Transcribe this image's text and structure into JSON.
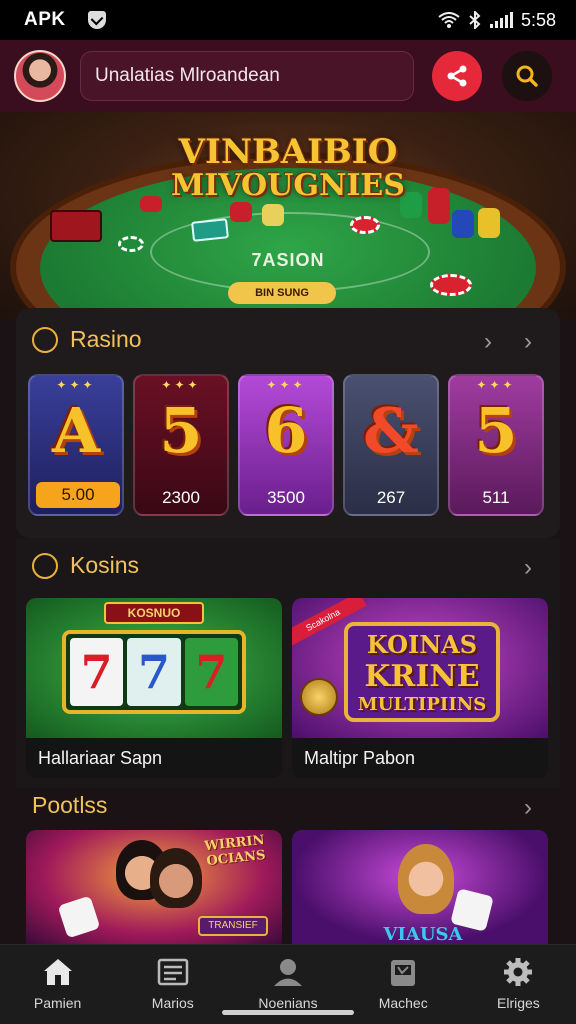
{
  "status_bar": {
    "left_text": "APK",
    "time": "5:58"
  },
  "header": {
    "search_text": "Unalatias Mlroandean",
    "share_icon": "share-icon",
    "search_icon": "search-icon"
  },
  "hero": {
    "title_line1": "VINBAIBIO",
    "title_line2": "MIVOUGNIES",
    "table_text": "7ASION",
    "pill_text": "BIN SUNG"
  },
  "section1": {
    "title": "Rasino",
    "cards": [
      {
        "letter": "A",
        "value": "5.00",
        "color_top": "#3a3f9a",
        "color_bottom": "#1e1f5c"
      },
      {
        "letter": "5",
        "value": "2300",
        "color_top": "#6a1024",
        "color_bottom": "#3a0815"
      },
      {
        "letter": "6",
        "value": "3500",
        "color_top": "#b44ad8",
        "color_bottom": "#6a1f8c"
      },
      {
        "letter": "&",
        "value": "267",
        "color_top": "#4a5070",
        "color_bottom": "#2a2e46"
      },
      {
        "letter": "5",
        "value": "511",
        "color_top": "#a03ca0",
        "color_bottom": "#5a1a5a"
      }
    ]
  },
  "section2": {
    "title": "Kosins",
    "tiles": [
      {
        "label": "Hallariaar Sapn",
        "banner": "KOSNUO",
        "reels": [
          "7",
          "7",
          "7"
        ]
      },
      {
        "label": "Maltipr Pabon",
        "line1": "KOINAS",
        "line2": "KRINE",
        "line3": "MULTIPIINS",
        "ribbon": "Scakolna"
      }
    ]
  },
  "section3": {
    "title": "Pootlss",
    "tiles": [
      {
        "badge": "WIRRIN OCIANS",
        "button": "TRANSIEF"
      },
      {
        "badge": "VIAUSA"
      }
    ]
  },
  "bottom_nav": [
    {
      "label": "Pamien",
      "icon": "home-icon"
    },
    {
      "label": "Marios",
      "icon": "list-icon"
    },
    {
      "label": "Noenians",
      "icon": "person-icon"
    },
    {
      "label": "Machec",
      "icon": "slots-icon"
    },
    {
      "label": "Elriges",
      "icon": "gear-icon"
    }
  ],
  "colors": {
    "header_bg": "#3a0d1f",
    "accent_gold": "#f1c15a",
    "accent_red": "#e5293b"
  }
}
